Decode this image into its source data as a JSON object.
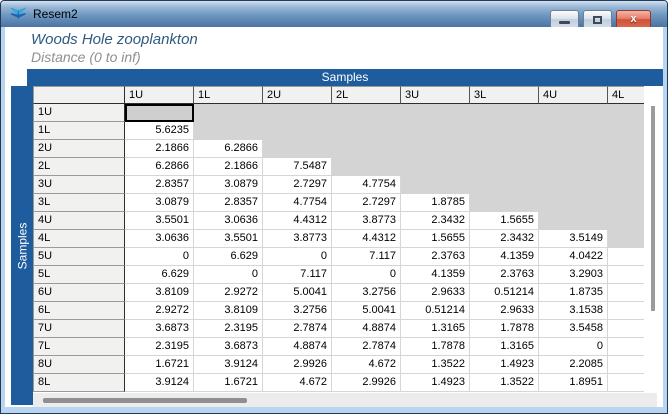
{
  "window": {
    "title": "Resem2",
    "buttons": {
      "minimize": "minimize",
      "restore": "restore",
      "close_glyph": "x"
    }
  },
  "header": {
    "title": "Woods Hole zooplankton",
    "subtitle": "Distance (0 to inf)"
  },
  "matrix": {
    "axis_label_top": "Samples",
    "axis_label_left": "Samples",
    "col_headers": [
      "1U",
      "1L",
      "2U",
      "2L",
      "3U",
      "3L",
      "4U",
      "4L"
    ],
    "row_headers": [
      "1U",
      "1L",
      "2U",
      "2L",
      "3U",
      "3L",
      "4U",
      "4L",
      "5U",
      "5L",
      "6U",
      "6L",
      "7U",
      "7L",
      "8U",
      "8L"
    ],
    "rows": [
      [
        "",
        "",
        "",
        "",
        "",
        "",
        "",
        ""
      ],
      [
        "5.6235",
        "",
        "",
        "",
        "",
        "",
        "",
        ""
      ],
      [
        "2.1866",
        "6.2866",
        "",
        "",
        "",
        "",
        "",
        ""
      ],
      [
        "6.2866",
        "2.1866",
        "7.5487",
        "",
        "",
        "",
        "",
        ""
      ],
      [
        "2.8357",
        "3.0879",
        "2.7297",
        "4.7754",
        "",
        "",
        "",
        ""
      ],
      [
        "3.0879",
        "2.8357",
        "4.7754",
        "2.7297",
        "1.8785",
        "",
        "",
        ""
      ],
      [
        "3.5501",
        "3.0636",
        "4.4312",
        "3.8773",
        "2.3432",
        "1.5655",
        "",
        ""
      ],
      [
        "3.0636",
        "3.5501",
        "3.8773",
        "4.4312",
        "1.5655",
        "2.3432",
        "3.5149",
        ""
      ],
      [
        "0",
        "6.629",
        "0",
        "7.117",
        "2.3763",
        "4.1359",
        "4.0422",
        ""
      ],
      [
        "6.629",
        "0",
        "7.117",
        "0",
        "4.1359",
        "2.3763",
        "3.2903",
        ""
      ],
      [
        "3.8109",
        "2.9272",
        "5.0041",
        "3.2756",
        "2.9633",
        "0.51214",
        "1.8735",
        ""
      ],
      [
        "2.9272",
        "3.8109",
        "3.2756",
        "5.0041",
        "0.51214",
        "2.9633",
        "3.1538",
        ""
      ],
      [
        "3.6873",
        "2.3195",
        "2.7874",
        "4.8874",
        "1.3165",
        "1.7878",
        "3.5458",
        ""
      ],
      [
        "2.3195",
        "3.6873",
        "4.8874",
        "2.7874",
        "1.7878",
        "1.3165",
        "0",
        ""
      ],
      [
        "1.6721",
        "3.9124",
        "2.9926",
        "4.672",
        "1.3522",
        "1.4923",
        "2.2085",
        ""
      ],
      [
        "3.9124",
        "1.6721",
        "4.672",
        "2.9926",
        "1.4923",
        "1.3522",
        "1.8951",
        ""
      ]
    ],
    "selected_cell": {
      "row": 0,
      "col": 0
    }
  },
  "colors": {
    "band_blue": "#1e5c9e",
    "upper_triangle_gray": "#d4d4d4",
    "header_bg": "#f1f1f0",
    "titlebar_blue": "#4a74a4",
    "close_red": "#cf523a"
  }
}
